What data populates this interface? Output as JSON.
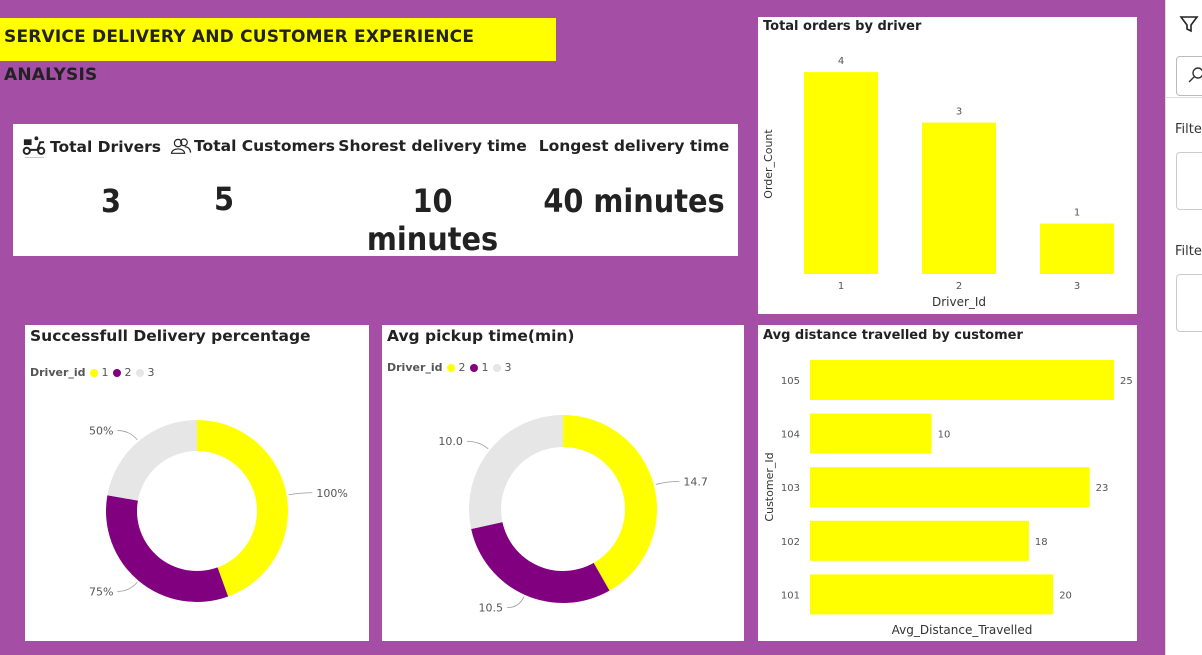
{
  "title": "SERVICE DELIVERY AND CUSTOMER EXPERIENCE ANALYSIS",
  "kpis": [
    {
      "label": "Total Drivers",
      "value": "3",
      "icon": "delivery-scooter-icon"
    },
    {
      "label": "Total Customers",
      "value": "5",
      "icon": "users-icon"
    },
    {
      "label": "Shorest delivery time",
      "value": "10 minutes"
    },
    {
      "label": "Longest delivery time",
      "value": "40 minutes"
    }
  ],
  "colors": {
    "yellow": "#ffff00",
    "purple": "#800080",
    "grey": "#e6e6e6",
    "canvas": "#a44ea6"
  },
  "side": {
    "filter_label_1": "Filte",
    "filter_label_2": "Filte"
  },
  "chart_data": [
    {
      "type": "bar",
      "title": "Total orders by driver",
      "xlabel": "Driver_Id",
      "ylabel": "Order_Count",
      "categories": [
        "1",
        "2",
        "3"
      ],
      "values": [
        4,
        3,
        1
      ],
      "ylim": [
        0,
        4.2
      ]
    },
    {
      "type": "pie",
      "title": "Successfull Delivery percentage",
      "legend_title": "Driver_id",
      "legend": [
        "1",
        "2",
        "3"
      ],
      "categories": [
        "1",
        "2",
        "3"
      ],
      "values": [
        100,
        75,
        50
      ],
      "labels": [
        "100%",
        "75%",
        "50%"
      ]
    },
    {
      "type": "pie",
      "title": "Avg pickup time(min)",
      "legend_title": "Driver_id",
      "legend": [
        "2",
        "1",
        "3"
      ],
      "categories": [
        "2",
        "1",
        "3"
      ],
      "values": [
        14.7,
        10.5,
        10.0
      ],
      "labels": [
        "14.7",
        "10.5",
        "10.0"
      ]
    },
    {
      "type": "bar",
      "orientation": "horizontal",
      "title": "Avg distance travelled by customer",
      "xlabel": "Avg_Distance_Travelled",
      "ylabel": "Customer_Id",
      "categories": [
        "105",
        "104",
        "103",
        "102",
        "101"
      ],
      "values": [
        25,
        10,
        23,
        18,
        20
      ],
      "xlim": [
        0,
        25
      ]
    }
  ]
}
